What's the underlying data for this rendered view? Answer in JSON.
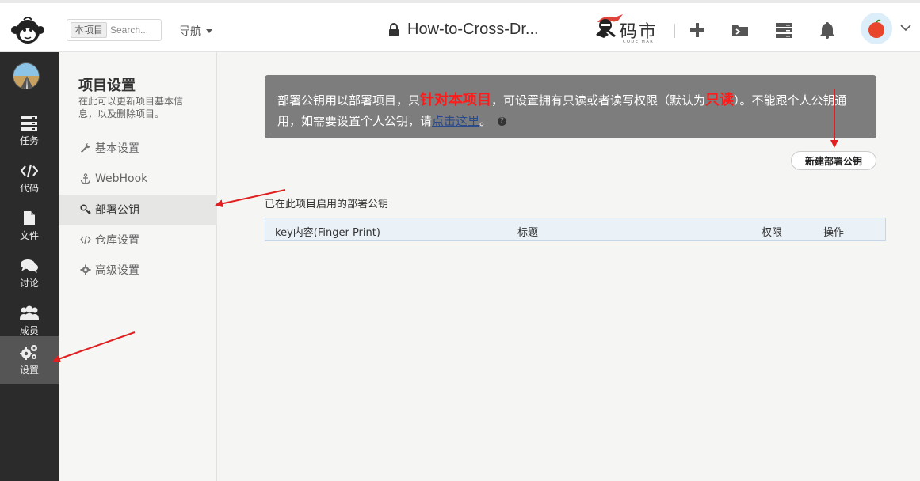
{
  "header": {
    "scope_tag": "本项目",
    "search_placeholder": "Search...",
    "nav_label": "导航",
    "project_title": "How-to-Cross-Dr...",
    "brand_text": "码市",
    "brand_sub": "CODE MART",
    "tools": [
      "plus-icon",
      "folder-terminal-icon",
      "server-icon",
      "bell-icon"
    ]
  },
  "sidebar": {
    "items": [
      {
        "label": "任务",
        "icon": "tasks-icon"
      },
      {
        "label": "代码",
        "icon": "code-icon"
      },
      {
        "label": "文件",
        "icon": "file-icon"
      },
      {
        "label": "讨论",
        "icon": "chat-icon"
      },
      {
        "label": "成员",
        "icon": "members-icon"
      },
      {
        "label": "设置",
        "icon": "gears-icon",
        "active": true
      }
    ]
  },
  "settings_nav": {
    "title": "项目设置",
    "description": "在此可以更新项目基本信息，以及删除项目。",
    "items": [
      {
        "label": "基本设置",
        "icon": "wrench-icon"
      },
      {
        "label": "WebHook",
        "icon": "anchor-icon"
      },
      {
        "label": "部署公钥",
        "icon": "key-icon",
        "active": true
      },
      {
        "label": "仓库设置",
        "icon": "code-icon"
      },
      {
        "label": "高级设置",
        "icon": "gear-icon"
      }
    ]
  },
  "notice": {
    "part1": "部署公钥用以部署项目，只",
    "highlight1": "针对本项目",
    "part2": "，可设置拥有只读或者读写权限（默认为",
    "highlight2": "只读",
    "part3": "）。不能跟个人公钥通用，如需要设置个人公钥，请",
    "link": "点击这里",
    "part4": "。"
  },
  "new_key_button": "新建部署公钥",
  "enabled_keys_label": "已在此项目启用的部署公钥",
  "table": {
    "headers": [
      "key内容(Finger Print)",
      "标题",
      "权限",
      "操作"
    ]
  },
  "colors": {
    "sidebar_bg": "#2b2b2b",
    "notice_bg": "#7d7d7d",
    "highlight": "#ff1a1a",
    "annotation_arrow": "#e02020",
    "table_header_bg": "#eaf1f7"
  }
}
